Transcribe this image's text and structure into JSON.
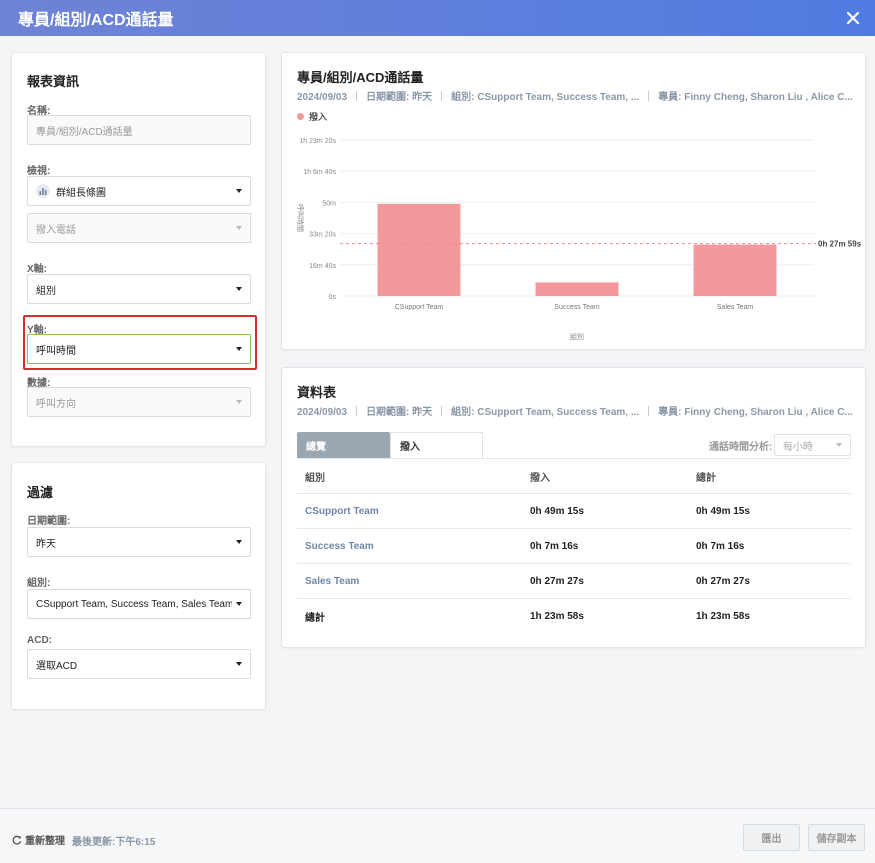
{
  "header": {
    "title": "專員/組別/ACD通話量"
  },
  "report_info": {
    "title": "報表資訊",
    "name_label": "名稱:",
    "name_placeholder": "專員/組別/ACD通話量",
    "view_label": "檢視:",
    "view_value": "群組長條圖",
    "view_sub_value": "撥入電話",
    "x_label": "X軸:",
    "x_value": "組別",
    "y_label": "Y軸:",
    "y_value": "呼叫時間",
    "data_label": "數據:",
    "data_value": "呼叫方向"
  },
  "filter": {
    "title": "過濾",
    "date_label": "日期範圍:",
    "date_value": "昨天",
    "group_label": "組別:",
    "group_value": "CSupport Team, Success Team, Sales Team",
    "acd_label": "ACD:",
    "acd_value": "選取ACD"
  },
  "chart_panel": {
    "title": "專員/組別/ACD通話量",
    "date": "2024/09/03",
    "range": "日期範圍: 昨天",
    "groups": "組別: CSupport Team, Success Team, ...",
    "agents": "專員: Finny Cheng, Sharon Liu , Alice C..."
  },
  "chart_data": {
    "type": "bar",
    "categories": [
      "CSupport Team",
      "Success Team",
      "Sales Team"
    ],
    "series": [
      {
        "name": "撥入",
        "values": [
          2955,
          436,
          1647
        ],
        "color": "#f4999b"
      }
    ],
    "yticks": [
      {
        "value": 0,
        "label": "0s"
      },
      {
        "value": 1000,
        "label": "16m 40s"
      },
      {
        "value": 2000,
        "label": "33m 20s"
      },
      {
        "value": 3000,
        "label": "50m"
      },
      {
        "value": 4000,
        "label": "1h 6m 40s"
      },
      {
        "value": 5000,
        "label": "1h 23m 20s"
      }
    ],
    "ylim": [
      0,
      5000
    ],
    "average_value": 1679,
    "average_label": "0h 27m 59s",
    "xlabel": "組別",
    "ylabel": "呼叫時間"
  },
  "table_panel": {
    "title": "資料表",
    "date": "2024/09/03",
    "range": "日期範圍: 昨天",
    "groups": "組別: CSupport Team, Success Team, ...",
    "agents": "專員: Finny Cheng, Sharon Liu , Alice C...",
    "tabs": [
      "總覽",
      "撥入"
    ],
    "analysis_label": "通話時間分析:",
    "analysis_value": "每小時",
    "columns": [
      "組別",
      "撥入",
      "總計"
    ],
    "rows": [
      [
        "CSupport Team",
        "0h 49m 15s",
        "0h 49m 15s"
      ],
      [
        "Success Team",
        "0h 7m 16s",
        "0h 7m 16s"
      ],
      [
        "Sales Team",
        "0h 27m 27s",
        "0h 27m 27s"
      ]
    ],
    "total_row": [
      "總計",
      "1h 23m 58s",
      "1h 23m 58s"
    ]
  },
  "footer": {
    "refresh_label": "重新整理",
    "last_update": "最後更新:下午6:15",
    "export_label": "匯出",
    "save_label": "儲存副本"
  }
}
